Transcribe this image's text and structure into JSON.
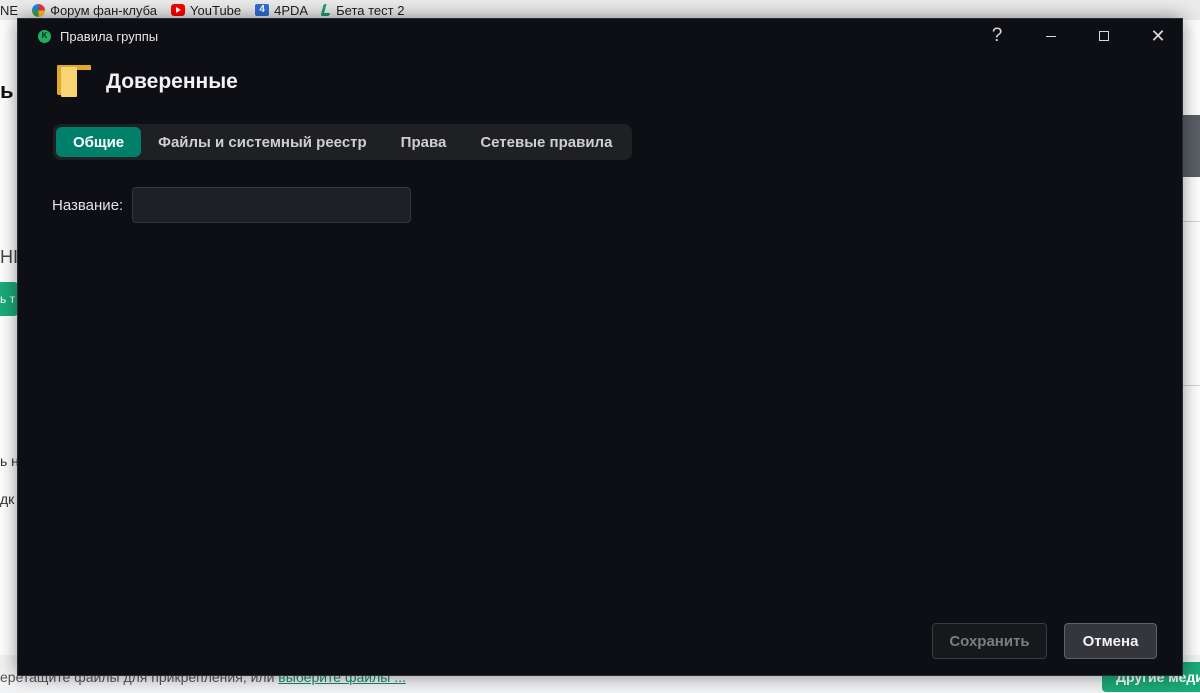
{
  "browser": {
    "bookmarks": [
      {
        "label": "NE",
        "icon": "none"
      },
      {
        "label": "Форум фан-клуба",
        "icon": "forum-icon"
      },
      {
        "label": "YouTube",
        "icon": "youtube-icon"
      },
      {
        "label": "4PDA",
        "icon": "4pda-icon"
      },
      {
        "label": "Бета тест 2",
        "icon": "beta-test-icon"
      }
    ]
  },
  "background_page": {
    "fragments": [
      "ь",
      "НI",
      "ь т",
      "ь н",
      "дк"
    ],
    "bottom_text": "еретащите файлы для прикрепления, или ",
    "bottom_link": "выберите файлы ...",
    "other_media_label": "Другие меди"
  },
  "dialog": {
    "window_title": "Правила группы",
    "window_controls": {
      "help": "?",
      "close": "✕"
    },
    "group_name": "Доверенные",
    "tabs": [
      {
        "label": "Общие",
        "active": true
      },
      {
        "label": "Файлы и системный реестр",
        "active": false
      },
      {
        "label": "Права",
        "active": false
      },
      {
        "label": "Сетевые правила",
        "active": false
      }
    ],
    "name_field": {
      "label": "Название:",
      "value": ""
    },
    "buttons": {
      "save": "Сохранить",
      "cancel": "Отмена"
    }
  },
  "colors": {
    "dialog_bg": "#0e0e15",
    "accent_active_tab": "#00806a",
    "input_bg": "#1d2024"
  }
}
